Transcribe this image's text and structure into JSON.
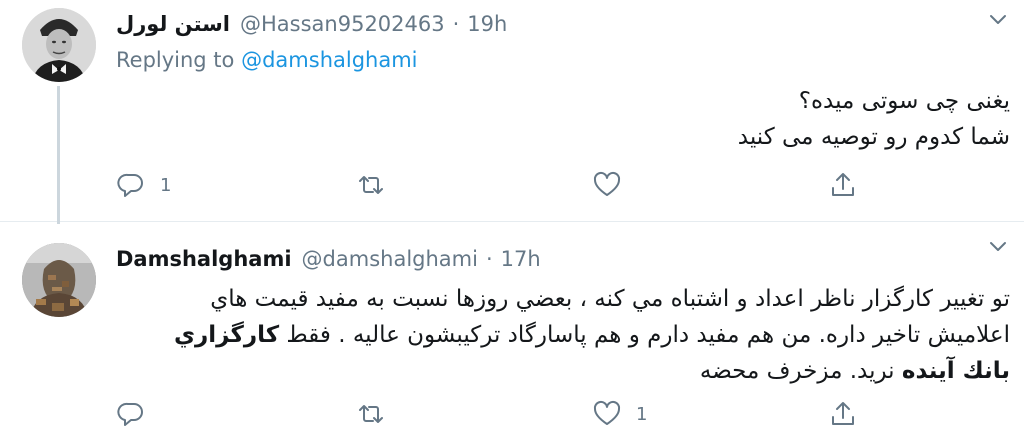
{
  "tweets": [
    {
      "display_name": "استن لورل",
      "handle": "@Hassan95202463",
      "separator": "·",
      "time": "19h",
      "replying_prefix": "Replying to",
      "replying_to": "@damshalghami",
      "text_lines": [
        "يغنى چى سوتى ميده؟",
        "شما كدوم رو توصيه مى كنيد"
      ],
      "reply_count": "1",
      "retweet_count": "",
      "like_count": ""
    },
    {
      "display_name": "Damshalghami",
      "handle": "@damshalghami",
      "separator": "·",
      "time": "17h",
      "text_line1": "تو تغيير كارگزار ناظر اعداد و اشتباه مي كنه ، بعضي روزها نسبت به مفيد قيمت هاي",
      "text_line2_normal": "اعلاميش تاخير داره. من هم مفيد دارم و هم پاسارگاد تركيبشون عاليه . فقط ",
      "text_line2_bold": "كارگزاري",
      "text_line3_bold": "بانك آينده",
      "text_line3_normal": " نريد. مزخرف محضه",
      "reply_count": "",
      "retweet_count": "",
      "like_count": "1"
    }
  ],
  "colors": {
    "text": "#14171a",
    "secondary": "#657786",
    "link": "#1b95e0",
    "thread_line": "#ccd6dd",
    "divider": "#e6ecf0"
  },
  "icons": [
    "avatar",
    "chevron-down-icon",
    "reply-icon",
    "retweet-icon",
    "like-icon",
    "share-icon"
  ]
}
